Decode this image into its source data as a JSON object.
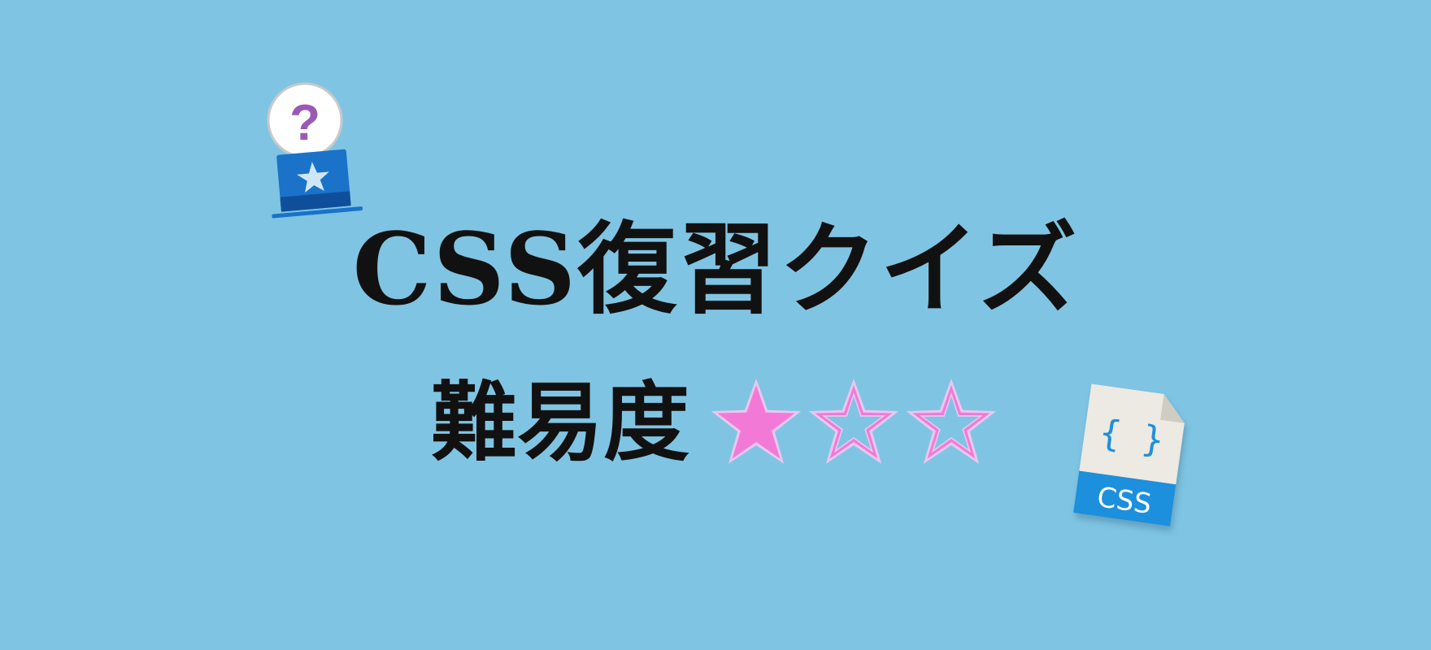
{
  "banner": {
    "title": "CSS復習クイズ",
    "difficulty_label": "難易度",
    "rating": {
      "filled": 1,
      "total": 3
    }
  },
  "icons": {
    "quiz_icon": {
      "name": "question-badge-icon",
      "glyph": "?"
    },
    "css_file_icon": {
      "name": "css-file-icon",
      "braces": "{ }",
      "label": "CSS"
    }
  },
  "colors": {
    "background": "#80c4e3",
    "text": "#111111",
    "star_fill": "#f27ad6",
    "star_outline": "#e9c7f0",
    "badge_blue": "#1a73c9",
    "badge_dark": "#0f4f9a",
    "question_purple": "#9b59b6",
    "file_paper": "#eceae2",
    "file_band": "#1f8fdd"
  }
}
